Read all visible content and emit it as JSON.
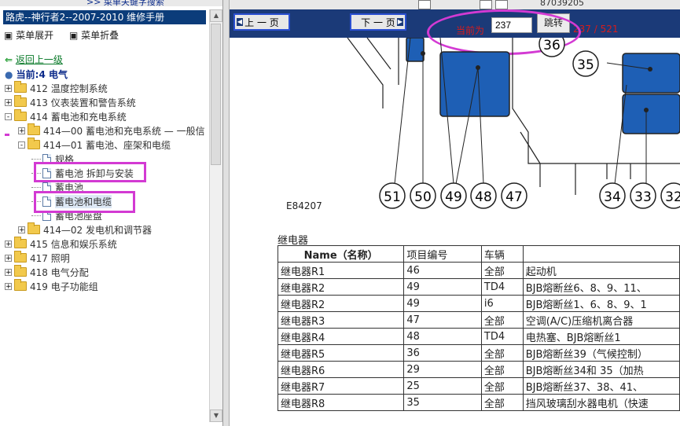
{
  "left": {
    "top_link": ">> 菜单关键字搜索",
    "title": "路虎--神行者2--2007-2010 维修手册",
    "expand_label": "菜单展开",
    "collapse_label": "菜单折叠",
    "back_label": "返回上一级",
    "current_label": "当前:4 电气",
    "tree": [
      {
        "id": "412",
        "label": "412 温度控制系统",
        "pm": "+",
        "indent": 0,
        "type": "folder"
      },
      {
        "id": "413",
        "label": "413 仪表装置和警告系统",
        "pm": "+",
        "indent": 0,
        "type": "folder"
      },
      {
        "id": "414",
        "label": "414 蓄电池和充电系统",
        "pm": "-",
        "indent": 0,
        "type": "folder"
      },
      {
        "id": "414-00",
        "label": "414—00 蓄电池和充电系统 — 一般信",
        "pm": "+",
        "indent": 1,
        "type": "folder"
      },
      {
        "id": "414-01",
        "label": "414—01 蓄电池、座架和电缆",
        "pm": "-",
        "indent": 1,
        "type": "folder"
      },
      {
        "id": "spec",
        "label": "规格",
        "pm": "",
        "indent": 2,
        "type": "doc"
      },
      {
        "id": "remove",
        "label": "蓄电池 拆卸与安装",
        "pm": "",
        "indent": 2,
        "type": "doc"
      },
      {
        "id": "battery",
        "label": "蓄电池",
        "pm": "",
        "indent": 2,
        "type": "doc"
      },
      {
        "id": "cable",
        "label": "蓄电池和电缆",
        "pm": "",
        "indent": 2,
        "type": "doc",
        "selected": true
      },
      {
        "id": "seat",
        "label": "蓄电池座盘",
        "pm": "",
        "indent": 2,
        "type": "doc"
      },
      {
        "id": "414-02",
        "label": "414—02 发电机和调节器",
        "pm": "+",
        "indent": 1,
        "type": "folder"
      },
      {
        "id": "415",
        "label": "415 信息和娱乐系统",
        "pm": "+",
        "indent": 0,
        "type": "folder"
      },
      {
        "id": "417",
        "label": "417 照明",
        "pm": "+",
        "indent": 0,
        "type": "folder"
      },
      {
        "id": "418",
        "label": "418 电气分配",
        "pm": "+",
        "indent": 0,
        "type": "folder"
      },
      {
        "id": "419",
        "label": "419 电子功能组",
        "pm": "+",
        "indent": 0,
        "type": "folder"
      }
    ]
  },
  "right": {
    "top_number": "87039205",
    "prev_label": "上 一 页",
    "next_label": "下 一 页",
    "current_page_label": "当前为",
    "page_input_value": "237",
    "go_label": "跳转",
    "page_count": "237 / 521",
    "figure_code": "E84207",
    "callouts_bottom": [
      "51",
      "50",
      "49",
      "48",
      "47",
      "34",
      "33",
      "32"
    ],
    "callouts_top": [
      "36",
      "35"
    ],
    "relay_title": "继电器",
    "table_headers": [
      "Name（名称）",
      "项目编号",
      "车辆",
      ""
    ],
    "table_rows": [
      [
        "继电器R1",
        "46",
        "全部",
        "起动机"
      ],
      [
        "继电器R2",
        "49",
        "TD4",
        "BJB熔断丝6、8、9、11、"
      ],
      [
        "继电器R2",
        "49",
        "i6",
        "BJB熔断丝1、6、8、9、1"
      ],
      [
        "继电器R3",
        "47",
        "全部",
        "空调(A/C)压缩机离合器"
      ],
      [
        "继电器R4",
        "48",
        "TD4",
        "电热塞、BJB熔断丝1"
      ],
      [
        "继电器R5",
        "36",
        "全部",
        "BJB熔断丝39（气候控制）"
      ],
      [
        "继电器R6",
        "29",
        "全部",
        "BJB熔断丝34和 35（加热"
      ],
      [
        "继电器R7",
        "25",
        "全部",
        "BJB熔断丝37、38、41、"
      ],
      [
        "继电器R8",
        "35",
        "全部",
        "挡风玻璃刮水器电机（快速"
      ]
    ]
  }
}
